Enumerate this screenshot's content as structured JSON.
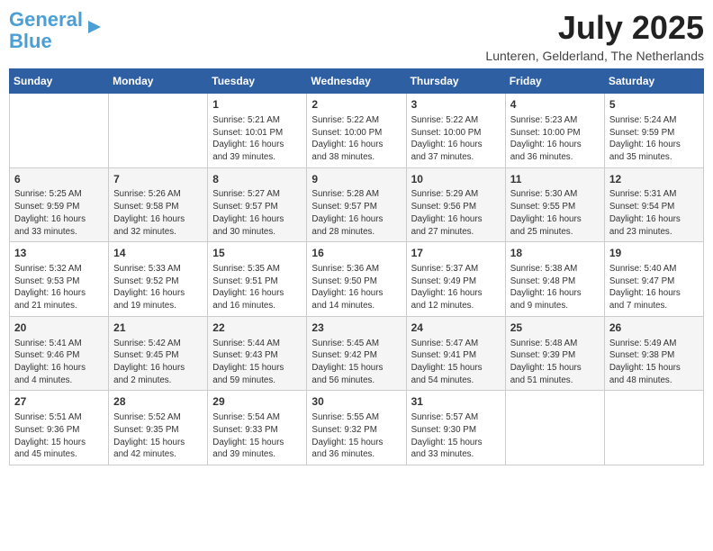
{
  "header": {
    "logo_line1": "General",
    "logo_line2": "Blue",
    "month_year": "July 2025",
    "location": "Lunteren, Gelderland, The Netherlands"
  },
  "days_of_week": [
    "Sunday",
    "Monday",
    "Tuesday",
    "Wednesday",
    "Thursday",
    "Friday",
    "Saturday"
  ],
  "weeks": [
    [
      {
        "day": "",
        "info": ""
      },
      {
        "day": "",
        "info": ""
      },
      {
        "day": "1",
        "info": "Sunrise: 5:21 AM\nSunset: 10:01 PM\nDaylight: 16 hours\nand 39 minutes."
      },
      {
        "day": "2",
        "info": "Sunrise: 5:22 AM\nSunset: 10:00 PM\nDaylight: 16 hours\nand 38 minutes."
      },
      {
        "day": "3",
        "info": "Sunrise: 5:22 AM\nSunset: 10:00 PM\nDaylight: 16 hours\nand 37 minutes."
      },
      {
        "day": "4",
        "info": "Sunrise: 5:23 AM\nSunset: 10:00 PM\nDaylight: 16 hours\nand 36 minutes."
      },
      {
        "day": "5",
        "info": "Sunrise: 5:24 AM\nSunset: 9:59 PM\nDaylight: 16 hours\nand 35 minutes."
      }
    ],
    [
      {
        "day": "6",
        "info": "Sunrise: 5:25 AM\nSunset: 9:59 PM\nDaylight: 16 hours\nand 33 minutes."
      },
      {
        "day": "7",
        "info": "Sunrise: 5:26 AM\nSunset: 9:58 PM\nDaylight: 16 hours\nand 32 minutes."
      },
      {
        "day": "8",
        "info": "Sunrise: 5:27 AM\nSunset: 9:57 PM\nDaylight: 16 hours\nand 30 minutes."
      },
      {
        "day": "9",
        "info": "Sunrise: 5:28 AM\nSunset: 9:57 PM\nDaylight: 16 hours\nand 28 minutes."
      },
      {
        "day": "10",
        "info": "Sunrise: 5:29 AM\nSunset: 9:56 PM\nDaylight: 16 hours\nand 27 minutes."
      },
      {
        "day": "11",
        "info": "Sunrise: 5:30 AM\nSunset: 9:55 PM\nDaylight: 16 hours\nand 25 minutes."
      },
      {
        "day": "12",
        "info": "Sunrise: 5:31 AM\nSunset: 9:54 PM\nDaylight: 16 hours\nand 23 minutes."
      }
    ],
    [
      {
        "day": "13",
        "info": "Sunrise: 5:32 AM\nSunset: 9:53 PM\nDaylight: 16 hours\nand 21 minutes."
      },
      {
        "day": "14",
        "info": "Sunrise: 5:33 AM\nSunset: 9:52 PM\nDaylight: 16 hours\nand 19 minutes."
      },
      {
        "day": "15",
        "info": "Sunrise: 5:35 AM\nSunset: 9:51 PM\nDaylight: 16 hours\nand 16 minutes."
      },
      {
        "day": "16",
        "info": "Sunrise: 5:36 AM\nSunset: 9:50 PM\nDaylight: 16 hours\nand 14 minutes."
      },
      {
        "day": "17",
        "info": "Sunrise: 5:37 AM\nSunset: 9:49 PM\nDaylight: 16 hours\nand 12 minutes."
      },
      {
        "day": "18",
        "info": "Sunrise: 5:38 AM\nSunset: 9:48 PM\nDaylight: 16 hours\nand 9 minutes."
      },
      {
        "day": "19",
        "info": "Sunrise: 5:40 AM\nSunset: 9:47 PM\nDaylight: 16 hours\nand 7 minutes."
      }
    ],
    [
      {
        "day": "20",
        "info": "Sunrise: 5:41 AM\nSunset: 9:46 PM\nDaylight: 16 hours\nand 4 minutes."
      },
      {
        "day": "21",
        "info": "Sunrise: 5:42 AM\nSunset: 9:45 PM\nDaylight: 16 hours\nand 2 minutes."
      },
      {
        "day": "22",
        "info": "Sunrise: 5:44 AM\nSunset: 9:43 PM\nDaylight: 15 hours\nand 59 minutes."
      },
      {
        "day": "23",
        "info": "Sunrise: 5:45 AM\nSunset: 9:42 PM\nDaylight: 15 hours\nand 56 minutes."
      },
      {
        "day": "24",
        "info": "Sunrise: 5:47 AM\nSunset: 9:41 PM\nDaylight: 15 hours\nand 54 minutes."
      },
      {
        "day": "25",
        "info": "Sunrise: 5:48 AM\nSunset: 9:39 PM\nDaylight: 15 hours\nand 51 minutes."
      },
      {
        "day": "26",
        "info": "Sunrise: 5:49 AM\nSunset: 9:38 PM\nDaylight: 15 hours\nand 48 minutes."
      }
    ],
    [
      {
        "day": "27",
        "info": "Sunrise: 5:51 AM\nSunset: 9:36 PM\nDaylight: 15 hours\nand 45 minutes."
      },
      {
        "day": "28",
        "info": "Sunrise: 5:52 AM\nSunset: 9:35 PM\nDaylight: 15 hours\nand 42 minutes."
      },
      {
        "day": "29",
        "info": "Sunrise: 5:54 AM\nSunset: 9:33 PM\nDaylight: 15 hours\nand 39 minutes."
      },
      {
        "day": "30",
        "info": "Sunrise: 5:55 AM\nSunset: 9:32 PM\nDaylight: 15 hours\nand 36 minutes."
      },
      {
        "day": "31",
        "info": "Sunrise: 5:57 AM\nSunset: 9:30 PM\nDaylight: 15 hours\nand 33 minutes."
      },
      {
        "day": "",
        "info": ""
      },
      {
        "day": "",
        "info": ""
      }
    ]
  ]
}
